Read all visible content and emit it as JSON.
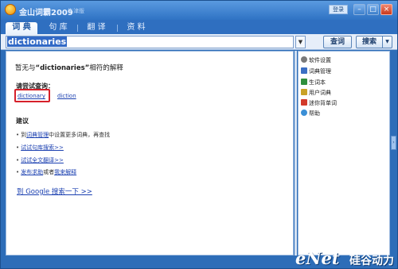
{
  "window": {
    "title": "金山词霸2009",
    "version": "牛津版",
    "login_label": "登录",
    "controls": {
      "minimize": "–",
      "maximize": "□",
      "close": "×"
    }
  },
  "tabs": [
    {
      "label": "词 典",
      "active": true
    },
    {
      "label": "句 库",
      "active": false
    },
    {
      "label": "翻 译",
      "active": false
    },
    {
      "label": "资 料",
      "active": false
    }
  ],
  "search": {
    "query": "dictionaries",
    "dropdown_glyph": "▼",
    "lookup_label": "查词",
    "search_label": "搜索",
    "search_arrow_glyph": "▼"
  },
  "result": {
    "no_result_prefix": "暂无与",
    "no_result_word": "“dictionaries”",
    "no_result_suffix": "相符的解释",
    "try_title": "请尝试查询：",
    "suggestions": [
      "dictionary",
      "diction"
    ],
    "advice_title": "建议",
    "advice": [
      {
        "before": "到",
        "link": "词典管理",
        "after": "中设置更多词典，再查找"
      },
      {
        "before": "",
        "link": "试试句库搜索>>",
        "after": ""
      },
      {
        "before": "",
        "link": "试试全文翻译>>",
        "after": ""
      },
      {
        "before": "",
        "link": "发布求助",
        "middle": "或者",
        "link2": "我来解释",
        "after": ""
      }
    ],
    "google_link": "到  Google  搜索一下  >>"
  },
  "side_panel": {
    "items": [
      {
        "label": "软件设置",
        "icon": "settings-icon",
        "color": "#7a7a7a"
      },
      {
        "label": "词典管理",
        "icon": "dictionary-manage-icon",
        "color": "#3b6fc4"
      },
      {
        "label": "生词本",
        "icon": "vocab-book-icon",
        "color": "#2f8f3c"
      },
      {
        "label": "用户词典",
        "icon": "user-dict-icon",
        "color": "#c9a227"
      },
      {
        "label": "迷你背单词",
        "icon": "mini-memorize-icon",
        "color": "#d23a2a"
      },
      {
        "label": "帮助",
        "icon": "help-icon",
        "color": "#3b8fd6"
      }
    ],
    "edge_glyph": "›"
  },
  "watermark": {
    "brand": "eNet",
    "cn": "硅谷动力"
  },
  "colors": {
    "accent": "#2d6db8",
    "link": "#1a3fb0",
    "highlight_box": "#d6202a"
  }
}
